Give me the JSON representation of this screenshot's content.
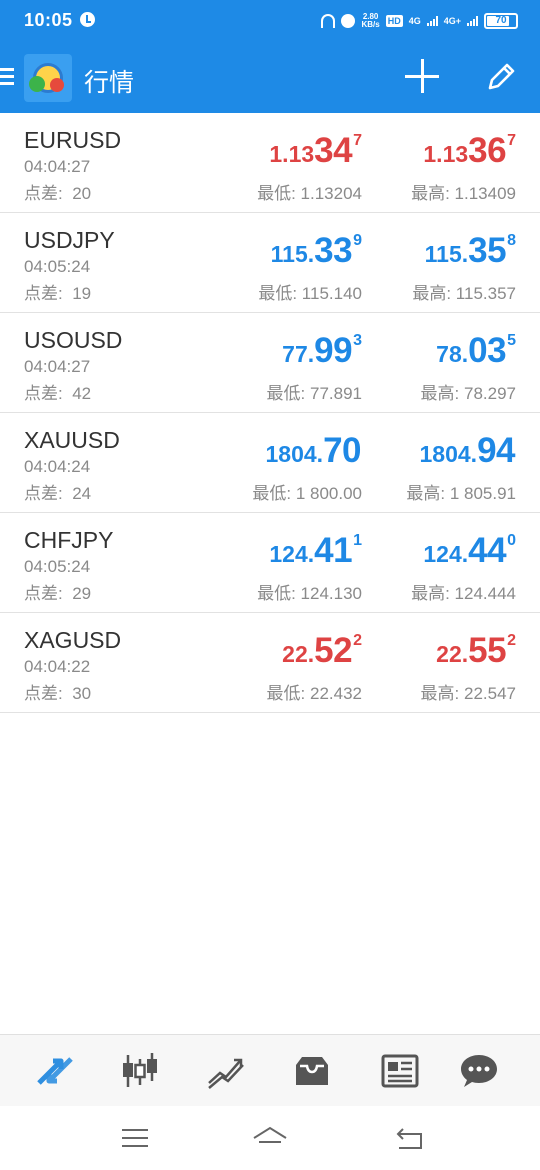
{
  "status_bar": {
    "time": "10:05",
    "speed_value": "2.80",
    "speed_unit": "KB/s",
    "hd_label": "HD",
    "sim1_label": "4G",
    "sim2_label": "4G+",
    "battery_level": "70"
  },
  "app_bar": {
    "title": "行情"
  },
  "quotes": [
    {
      "symbol": "EURUSD",
      "time": "04:04:27",
      "spread_label": "点差:",
      "spread": "20",
      "bid": {
        "small": "1.13",
        "big": "34",
        "sup": "7"
      },
      "ask": {
        "small": "1.13",
        "big": "36",
        "sup": "7"
      },
      "low": "最低: 1.13204",
      "high": "最高: 1.13409",
      "color": "#de4343"
    },
    {
      "symbol": "USDJPY",
      "time": "04:05:24",
      "spread_label": "点差:",
      "spread": "19",
      "bid": {
        "small": "115.",
        "big": "33",
        "sup": "9"
      },
      "ask": {
        "small": "115.",
        "big": "35",
        "sup": "8"
      },
      "low": "最低: 115.140",
      "high": "最高: 115.357",
      "color": "#1e88e5"
    },
    {
      "symbol": "USOUSD",
      "time": "04:04:27",
      "spread_label": "点差:",
      "spread": "42",
      "bid": {
        "small": "77.",
        "big": "99",
        "sup": "3"
      },
      "ask": {
        "small": "78.",
        "big": "03",
        "sup": "5"
      },
      "low": "最低: 77.891",
      "high": "最高: 78.297",
      "color": "#1e88e5"
    },
    {
      "symbol": "XAUUSD",
      "time": "04:04:24",
      "spread_label": "点差:",
      "spread": "24",
      "bid": {
        "small": "1804.",
        "big": "70",
        "sup": ""
      },
      "ask": {
        "small": "1804.",
        "big": "94",
        "sup": ""
      },
      "low": "最低: 1 800.00",
      "high": "最高: 1 805.91",
      "color": "#1e88e5"
    },
    {
      "symbol": "CHFJPY",
      "time": "04:05:24",
      "spread_label": "点差:",
      "spread": "29",
      "bid": {
        "small": "124.",
        "big": "41",
        "sup": "1"
      },
      "ask": {
        "small": "124.",
        "big": "44",
        "sup": "0"
      },
      "low": "最低: 124.130",
      "high": "最高: 124.444",
      "color": "#1e88e5"
    },
    {
      "symbol": "XAGUSD",
      "time": "04:04:22",
      "spread_label": "点差:",
      "spread": "30",
      "bid": {
        "small": "22.",
        "big": "52",
        "sup": "2"
      },
      "ask": {
        "small": "22.",
        "big": "55",
        "sup": "2"
      },
      "low": "最低: 22.432",
      "high": "最高: 22.547",
      "color": "#de4343"
    }
  ],
  "tab_bar": {
    "tabs": [
      {
        "icon": "quotes-arrows-icon",
        "active": true
      },
      {
        "icon": "candlestick-chart-icon",
        "active": false
      },
      {
        "icon": "trade-lines-icon",
        "active": false
      },
      {
        "icon": "inbox-tray-icon",
        "active": false
      },
      {
        "icon": "news-paper-icon",
        "active": false
      },
      {
        "icon": "chat-bubble-icon",
        "active": false
      }
    ],
    "active_color": "#2f8fe0",
    "inactive_color": "#555555"
  },
  "system_nav": {
    "icons": [
      "menu-lines-icon",
      "home-icon",
      "back-icon"
    ]
  },
  "colors": {
    "brand": "#1e8ae6",
    "price_up": "#1e88e5",
    "price_down": "#de4343"
  }
}
